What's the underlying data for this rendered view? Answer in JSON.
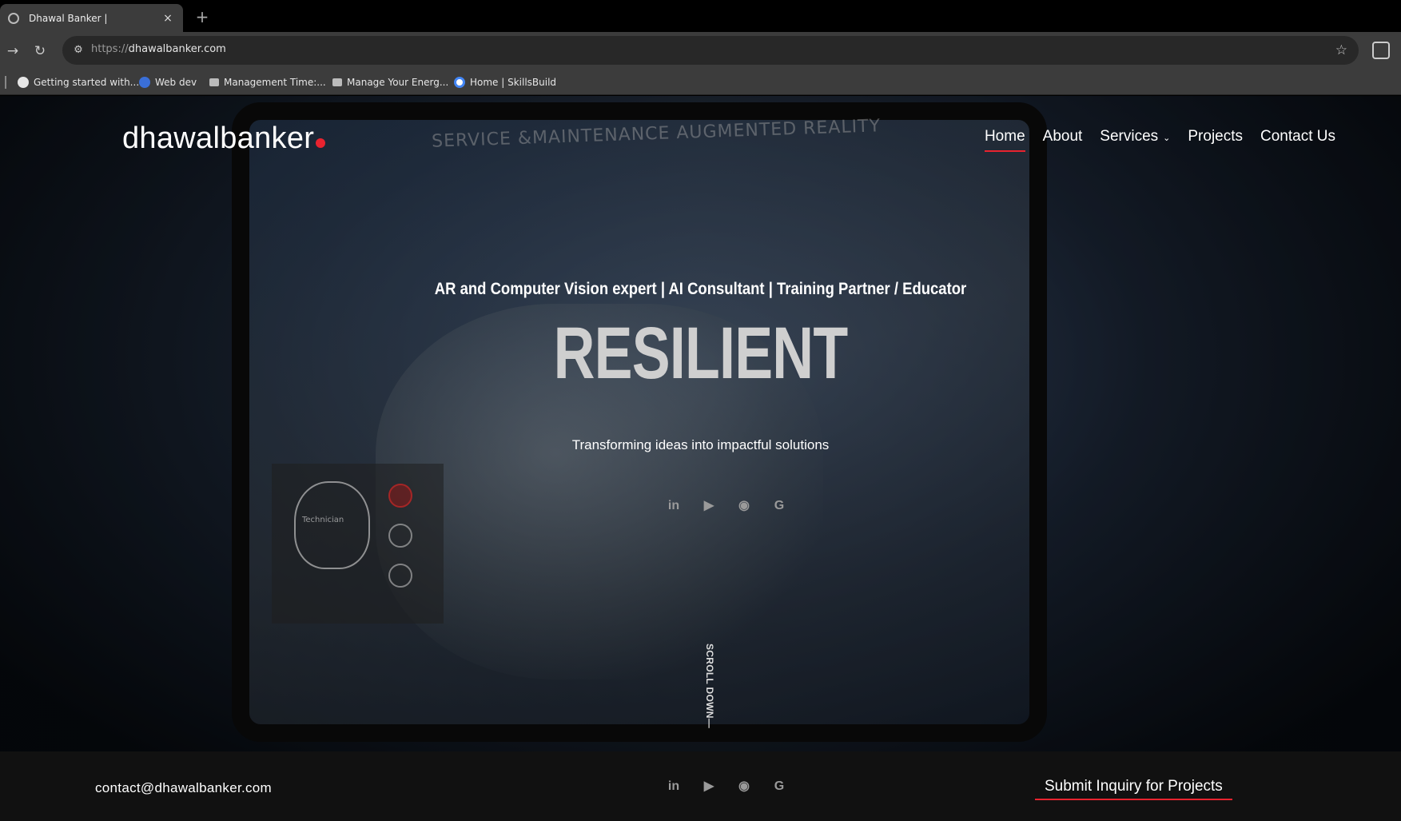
{
  "browser": {
    "tab": {
      "title": "Dhawal Banker |",
      "close": "×"
    },
    "new_tab": "+",
    "nav": {
      "back": "→",
      "reload": "↻",
      "site_info": "⚙"
    },
    "omnibox": {
      "scheme": "https://",
      "host": "dhawalbanker.com",
      "star": "☆"
    },
    "bookmarks": [
      {
        "label": "Getting started with...",
        "icon_color": "#e6e6e6"
      },
      {
        "label": "Web dev",
        "icon_color": "#3a6fd8"
      },
      {
        "label": "Management Time:...",
        "icon_color": "#bbbbbb"
      },
      {
        "label": "Manage Your Energ...",
        "icon_color": "#bbbbbb"
      },
      {
        "label": "Home | SkillsBuild",
        "icon_color": "#4285f4"
      }
    ]
  },
  "site": {
    "brand": "dhawalbanker",
    "brand_dot_color": "#e8232f",
    "nav": [
      {
        "label": "Home",
        "active": true
      },
      {
        "label": "About"
      },
      {
        "label": "Services",
        "caret": "⌄"
      },
      {
        "label": "Projects"
      },
      {
        "label": "Contact Us"
      }
    ],
    "hero": {
      "background_label": "SERVICE &MAINTENANCE  AUGMENTED REALITY",
      "hud_label": "Technician",
      "tagline": "AR and Computer Vision expert | AI Consultant | Training Partner / Educator",
      "headline": "RESILIENT",
      "subline": "Transforming ideas into impactful solutions",
      "socials": [
        {
          "icon": "linkedin-icon",
          "glyph": "in"
        },
        {
          "icon": "youtube-icon",
          "glyph": "▶"
        },
        {
          "icon": "github-icon",
          "glyph": "◉"
        },
        {
          "icon": "google-icon",
          "glyph": "G"
        }
      ],
      "scroll_label": "SCROLL DOWN—"
    },
    "footer": {
      "email": "contact@dhawalbanker.com",
      "cta": "Submit Inquiry for Projects"
    }
  }
}
